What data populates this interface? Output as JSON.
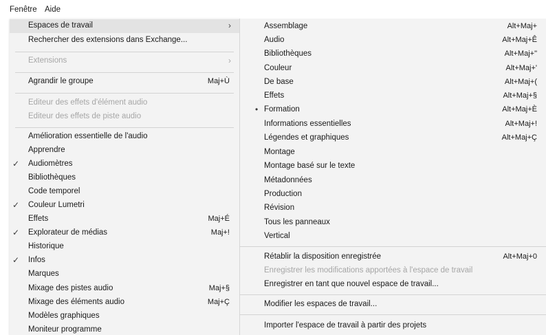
{
  "menubar": {
    "items": [
      {
        "label": "Fenêtre"
      },
      {
        "label": "Aide"
      }
    ]
  },
  "main_menu": {
    "items": [
      {
        "label": "Espaces de travail",
        "arrow": "›",
        "highlighted": true
      },
      {
        "label": "Rechercher des extensions dans Exchange..."
      },
      {
        "label": "Extensions",
        "arrow": "›",
        "disabled": true
      },
      {
        "label": "Agrandir le groupe",
        "shortcut": "Maj+Ù"
      },
      {
        "label": "Editeur des effets d'élément audio",
        "disabled": true
      },
      {
        "label": "Editeur des effets de piste audio",
        "disabled": true
      },
      {
        "label": "Amélioration essentielle de l'audio"
      },
      {
        "label": "Apprendre"
      },
      {
        "label": "Audiomètres",
        "checked": true
      },
      {
        "label": "Bibliothèques"
      },
      {
        "label": "Code temporel"
      },
      {
        "label": "Couleur Lumetri",
        "checked": true
      },
      {
        "label": "Effets",
        "shortcut": "Maj+É"
      },
      {
        "label": "Explorateur de médias",
        "checked": true,
        "shortcut": "Maj+!"
      },
      {
        "label": "Historique"
      },
      {
        "label": "Infos",
        "checked": true
      },
      {
        "label": "Marques"
      },
      {
        "label": "Mixage des pistes audio",
        "shortcut": "Maj+§"
      },
      {
        "label": "Mixage des éléments audio",
        "shortcut": "Maj+Ç"
      },
      {
        "label": "Modèles graphiques"
      },
      {
        "label": "Moniteur programme"
      }
    ]
  },
  "sub_menu": {
    "items": [
      {
        "label": "Assemblage",
        "shortcut": "Alt+Maj+"
      },
      {
        "label": "Audio",
        "shortcut": "Alt+Maj+Ê"
      },
      {
        "label": "Bibliothèques",
        "shortcut": "Alt+Maj+\""
      },
      {
        "label": "Couleur",
        "shortcut": "Alt+Maj+'"
      },
      {
        "label": "De base",
        "shortcut": "Alt+Maj+("
      },
      {
        "label": "Effets",
        "shortcut": "Alt+Maj+§"
      },
      {
        "label": "Formation",
        "shortcut": "Alt+Maj+È",
        "bullet": "•"
      },
      {
        "label": "Informations essentielles",
        "shortcut": "Alt+Maj+!"
      },
      {
        "label": "Légendes et graphiques",
        "shortcut": "Alt+Maj+Ç"
      },
      {
        "label": "Montage"
      },
      {
        "label": "Montage basé sur le texte"
      },
      {
        "label": "Métadonnées"
      },
      {
        "label": "Production"
      },
      {
        "label": "Révision"
      },
      {
        "label": "Tous les panneaux"
      },
      {
        "label": "Vertical"
      },
      {
        "label": "Rétablir la disposition enregistrée",
        "shortcut": "Alt+Maj+0"
      },
      {
        "label": "Enregistrer les modifications apportées à l'espace de travail",
        "disabled": true
      },
      {
        "label": "Enregistrer en tant que nouvel espace de travail..."
      },
      {
        "label": "Modifier les espaces de travail..."
      },
      {
        "label": "Importer l'espace de travail à partir des projets"
      }
    ]
  },
  "glyphs": {
    "check": "✓"
  }
}
